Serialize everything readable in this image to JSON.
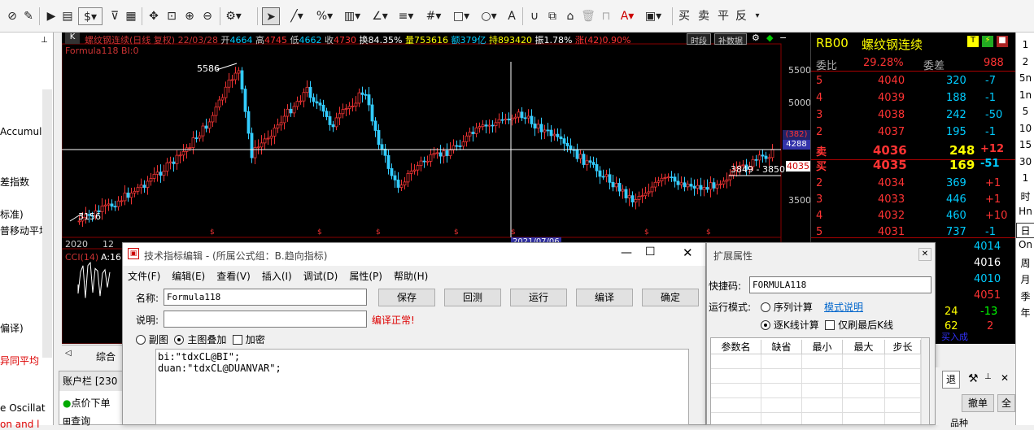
{
  "toolbar": {
    "icons": [
      "cursor-icon",
      "line-icon",
      "percent-icon",
      "bars-icon",
      "angle-icon",
      "parallel-icon",
      "grid-icon",
      "rect-icon",
      "circle-icon",
      "text-icon",
      "magnet-icon",
      "copy-icon",
      "delete-icon",
      "lock-icon",
      "color-icon",
      "save-icon"
    ],
    "currency": "$",
    "buy": "买",
    "sell": "卖",
    "flat": "平",
    "reverse": "反"
  },
  "left_panel": {
    "items": [
      "Accumul",
      "差指数",
      "标准)",
      "普移动平均",
      "偏译)",
      "异同平均",
      "e Oscillat",
      "on and l"
    ]
  },
  "chart": {
    "header": {
      "badge": "K",
      "name": "螺纹钢连续(日线 复权)",
      "date": "22/03/28",
      "open_label": "开",
      "open": "4664",
      "high_label": "高",
      "high": "4745",
      "low_label": "低",
      "low": "4662",
      "close_label": "收",
      "close": "4730",
      "turnover": "换84.35%",
      "volume": "量753616",
      "amount": "额379亿",
      "hold": "持893420",
      "amp": "振1.78%",
      "change": "涨(42)0.90%",
      "btn_period": "时段",
      "btn_data": "补数据"
    },
    "formula_line": "Formula118 BI:0",
    "labels": {
      "peak": "5586",
      "trough": "3156",
      "marker": "3849 - 3850"
    },
    "price_axis": [
      "5500",
      "5000",
      "4500",
      "4000",
      "3500"
    ],
    "price_tags": {
      "cross_top": "(382)",
      "cross_val": "4288",
      "last": "4035"
    },
    "date_axis": {
      "left": "2020",
      "next": "12",
      "mid_highlight": "2021/07/06"
    },
    "sub_label": "CCI(14)",
    "sub_value": "A:16",
    "bottom_tab": "综合"
  },
  "quote": {
    "code": "RB00",
    "name": "螺纹钢连续",
    "weibi_label": "委比",
    "weibi": "29.28%",
    "weicha_label": "委差",
    "weicha": "988",
    "asks": [
      {
        "lvl": "5",
        "price": "4040",
        "vol": "320",
        "chg": "-7"
      },
      {
        "lvl": "4",
        "price": "4039",
        "vol": "188",
        "chg": "-1"
      },
      {
        "lvl": "3",
        "price": "4038",
        "vol": "242",
        "chg": "-50"
      },
      {
        "lvl": "2",
        "price": "4037",
        "vol": "195",
        "chg": "-1"
      },
      {
        "lvl": "卖",
        "price": "4036",
        "vol": "248",
        "chg": "+12"
      }
    ],
    "bids": [
      {
        "lvl": "买",
        "price": "4035",
        "vol": "169",
        "chg": "-51"
      },
      {
        "lvl": "2",
        "price": "4034",
        "vol": "369",
        "chg": "+1"
      },
      {
        "lvl": "3",
        "price": "4033",
        "vol": "446",
        "chg": "+1"
      },
      {
        "lvl": "4",
        "price": "4032",
        "vol": "460",
        "chg": "+10"
      },
      {
        "lvl": "5",
        "price": "4031",
        "vol": "737",
        "chg": "-1"
      }
    ],
    "extra": [
      "4014",
      "4016",
      "4010",
      "4051"
    ],
    "foot": {
      "a": "24",
      "b": "-13",
      "c": "62",
      "d": "2"
    },
    "tag_bottom": "买入成"
  },
  "periods": [
    "1",
    "2",
    "5n",
    "1n",
    "5",
    "10",
    "15",
    "30",
    "1",
    "时",
    "Hn",
    "日",
    "On",
    "周",
    "月",
    "季",
    "年"
  ],
  "editor": {
    "title": "技术指标编辑 - (所属公式组：B.趋向指标)",
    "menu": [
      "文件(F)",
      "编辑(E)",
      "查看(V)",
      "插入(I)",
      "调试(D)",
      "属性(P)",
      "帮助(H)"
    ],
    "name_label": "名称:",
    "name_value": "Formula118",
    "desc_label": "说明:",
    "desc_value": "",
    "status": "编译正常!",
    "buttons": {
      "save": "保存",
      "test": "回测",
      "run": "运行",
      "compile": "编译",
      "ok": "确定"
    },
    "opt_sub": "副图",
    "opt_main": "主图叠加",
    "opt_lock": "加密",
    "code": [
      "bi:\"tdxCL@BI\";",
      "duan:\"tdxCL@DUANVAR\";"
    ]
  },
  "ext": {
    "title": "扩展属性",
    "hotkey_label": "快捷码:",
    "hotkey_value": "FORMULA118",
    "mode_label": "运行模式:",
    "mode_seq": "序列计算",
    "mode_help": "模式说明",
    "mode_step": "逐K线计算",
    "mode_last": "仅刷最后K线",
    "table_headers": [
      "参数名",
      "缺省",
      "最小",
      "最大",
      "步长"
    ]
  },
  "account": {
    "title": "账户栏 [230",
    "item1": "点价下单",
    "item2": "查询"
  },
  "right_bottom": {
    "btn_back": "退",
    "btn_cancel": "撤单",
    "btn_all": "全",
    "col": "品种"
  }
}
